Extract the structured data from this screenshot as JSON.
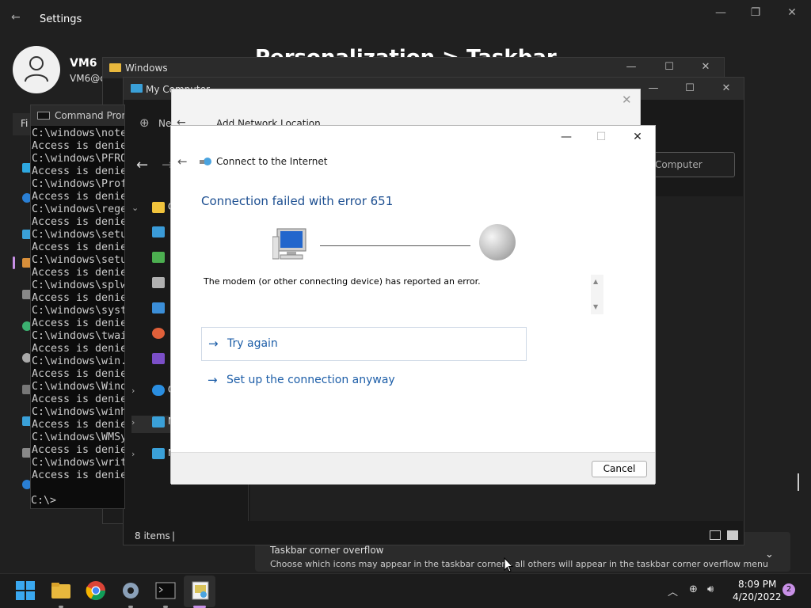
{
  "settings": {
    "title": "Settings",
    "user_name": "VM6",
    "user_email": "VM6@c",
    "heading": "Personalization > Taskbar",
    "left_tab": "Fi",
    "overflow_title": "Taskbar corner overflow",
    "overflow_desc": "Choose which icons may appear in the taskbar corner – all others will appear in the taskbar corner overflow menu"
  },
  "explorer_windows": {
    "title": "Windows"
  },
  "explorer_mycomputer": {
    "title": "My Computer",
    "new_label": "Ne",
    "search_placeholder": "Computer",
    "nav_items": [
      {
        "label": "Q",
        "color": "#f0c33c"
      },
      {
        "label": "",
        "color": "#3a9bd8"
      },
      {
        "label": "",
        "color": "#4caf50"
      },
      {
        "label": "",
        "color": "#b0b0b0"
      },
      {
        "label": "",
        "color": "#3b8ed8"
      },
      {
        "label": "",
        "color": "#e0603a"
      },
      {
        "label": "",
        "color": "#7b4fc8"
      },
      {
        "label": "O",
        "color": "#2a8ee0"
      },
      {
        "label": "M",
        "color": "#3aa0d8"
      },
      {
        "label": "N",
        "color": "#3aa0d8"
      }
    ],
    "status_count": "8 items"
  },
  "cmd": {
    "title": "Command Prompt",
    "lines": [
      "C:\\windows\\note",
      "Access is denie",
      "C:\\windows\\PFRO",
      "Access is denie",
      "C:\\windows\\Prof",
      "Access is denie",
      "C:\\windows\\rege",
      "Access is denie",
      "C:\\windows\\setu",
      "Access is denie",
      "C:\\windows\\setu",
      "Access is denie",
      "C:\\windows\\splw",
      "Access is denie",
      "C:\\windows\\syst",
      "Access is denie",
      "C:\\windows\\twai",
      "Access is denie",
      "C:\\windows\\win.",
      "Access is denie",
      "C:\\windows\\Wind",
      "Access is denie",
      "C:\\windows\\winh",
      "Access is denie",
      "C:\\windows\\WMSy",
      "Access is denie",
      "C:\\windows\\writ",
      "Access is denie"
    ],
    "prompt": "C:\\>"
  },
  "wizard": {
    "title": "Add Network Location"
  },
  "dialog": {
    "title": "Connect to the Internet",
    "heading": "Connection failed with error 651",
    "message": "The modem (or other connecting device) has reported an error.",
    "option_try_again": "Try again",
    "option_setup_anyway": "Set up the connection anyway",
    "cancel_label": "Cancel"
  },
  "taskbar": {
    "time": "8:09 PM",
    "date": "4/20/2022",
    "notification_count": "2",
    "apps": [
      "start-icon",
      "file-explorer-icon",
      "chrome-icon",
      "settings-icon",
      "terminal-icon",
      "network-wizard-icon"
    ]
  }
}
